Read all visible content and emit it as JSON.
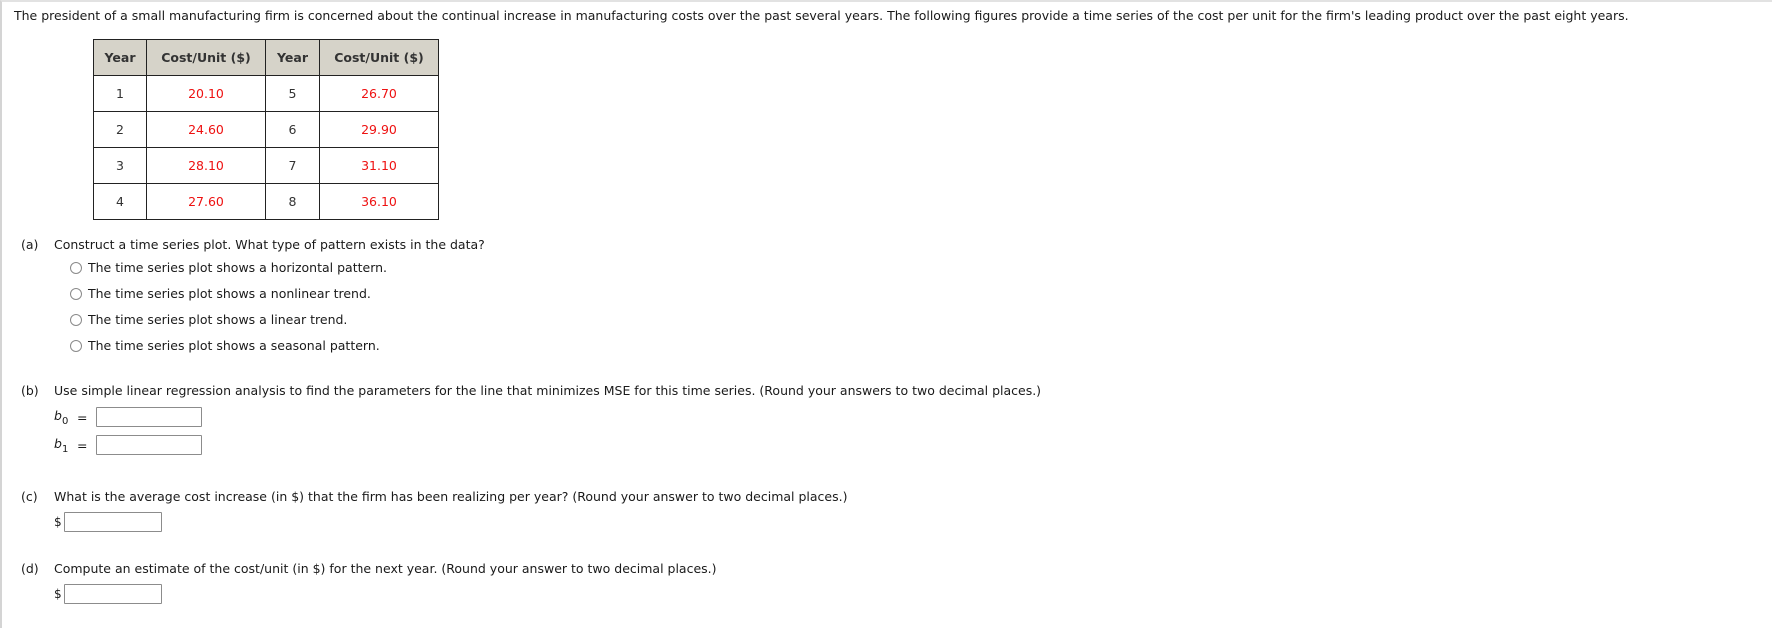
{
  "intro": "The president of a small manufacturing firm is concerned about the continual increase in manufacturing costs over the past several years. The following figures provide a time series of the cost per unit for the firm's leading product over the past eight years.",
  "table": {
    "headers": [
      "Year",
      "Cost/Unit ($)",
      "Year",
      "Cost/Unit ($)"
    ],
    "rows": [
      {
        "year_a": "1",
        "cost_a": "20.10",
        "year_b": "5",
        "cost_b": "26.70"
      },
      {
        "year_a": "2",
        "cost_a": "24.60",
        "year_b": "6",
        "cost_b": "29.90"
      },
      {
        "year_a": "3",
        "cost_a": "28.10",
        "year_b": "7",
        "cost_b": "31.10"
      },
      {
        "year_a": "4",
        "cost_a": "27.60",
        "year_b": "8",
        "cost_b": "36.10"
      }
    ],
    "value_color": "#ee1111"
  },
  "part_a": {
    "label": "(a)",
    "question": "Construct a time series plot. What type of pattern exists in the data?",
    "options": [
      "The time series plot shows a horizontal pattern.",
      "The time series plot shows a nonlinear trend.",
      "The time series plot shows a linear trend.",
      "The time series plot shows a seasonal pattern."
    ]
  },
  "part_b": {
    "label": "(b)",
    "question": "Use simple linear regression analysis to find the parameters for the line that minimizes MSE for this time series. (Round your answers to two decimal places.)",
    "b0_var": "b",
    "b0_sub": "0",
    "b1_var": "b",
    "b1_sub": "1",
    "equals": "=",
    "b0_value": "",
    "b1_value": ""
  },
  "part_c": {
    "label": "(c)",
    "question": "What is the average cost increase (in $) that the firm has been realizing per year? (Round your answer to two decimal places.)",
    "currency": "$",
    "value": ""
  },
  "part_d": {
    "label": "(d)",
    "question": "Compute an estimate of the cost/unit (in $) for the next year. (Round your answer to two decimal places.)",
    "currency": "$",
    "value": ""
  }
}
